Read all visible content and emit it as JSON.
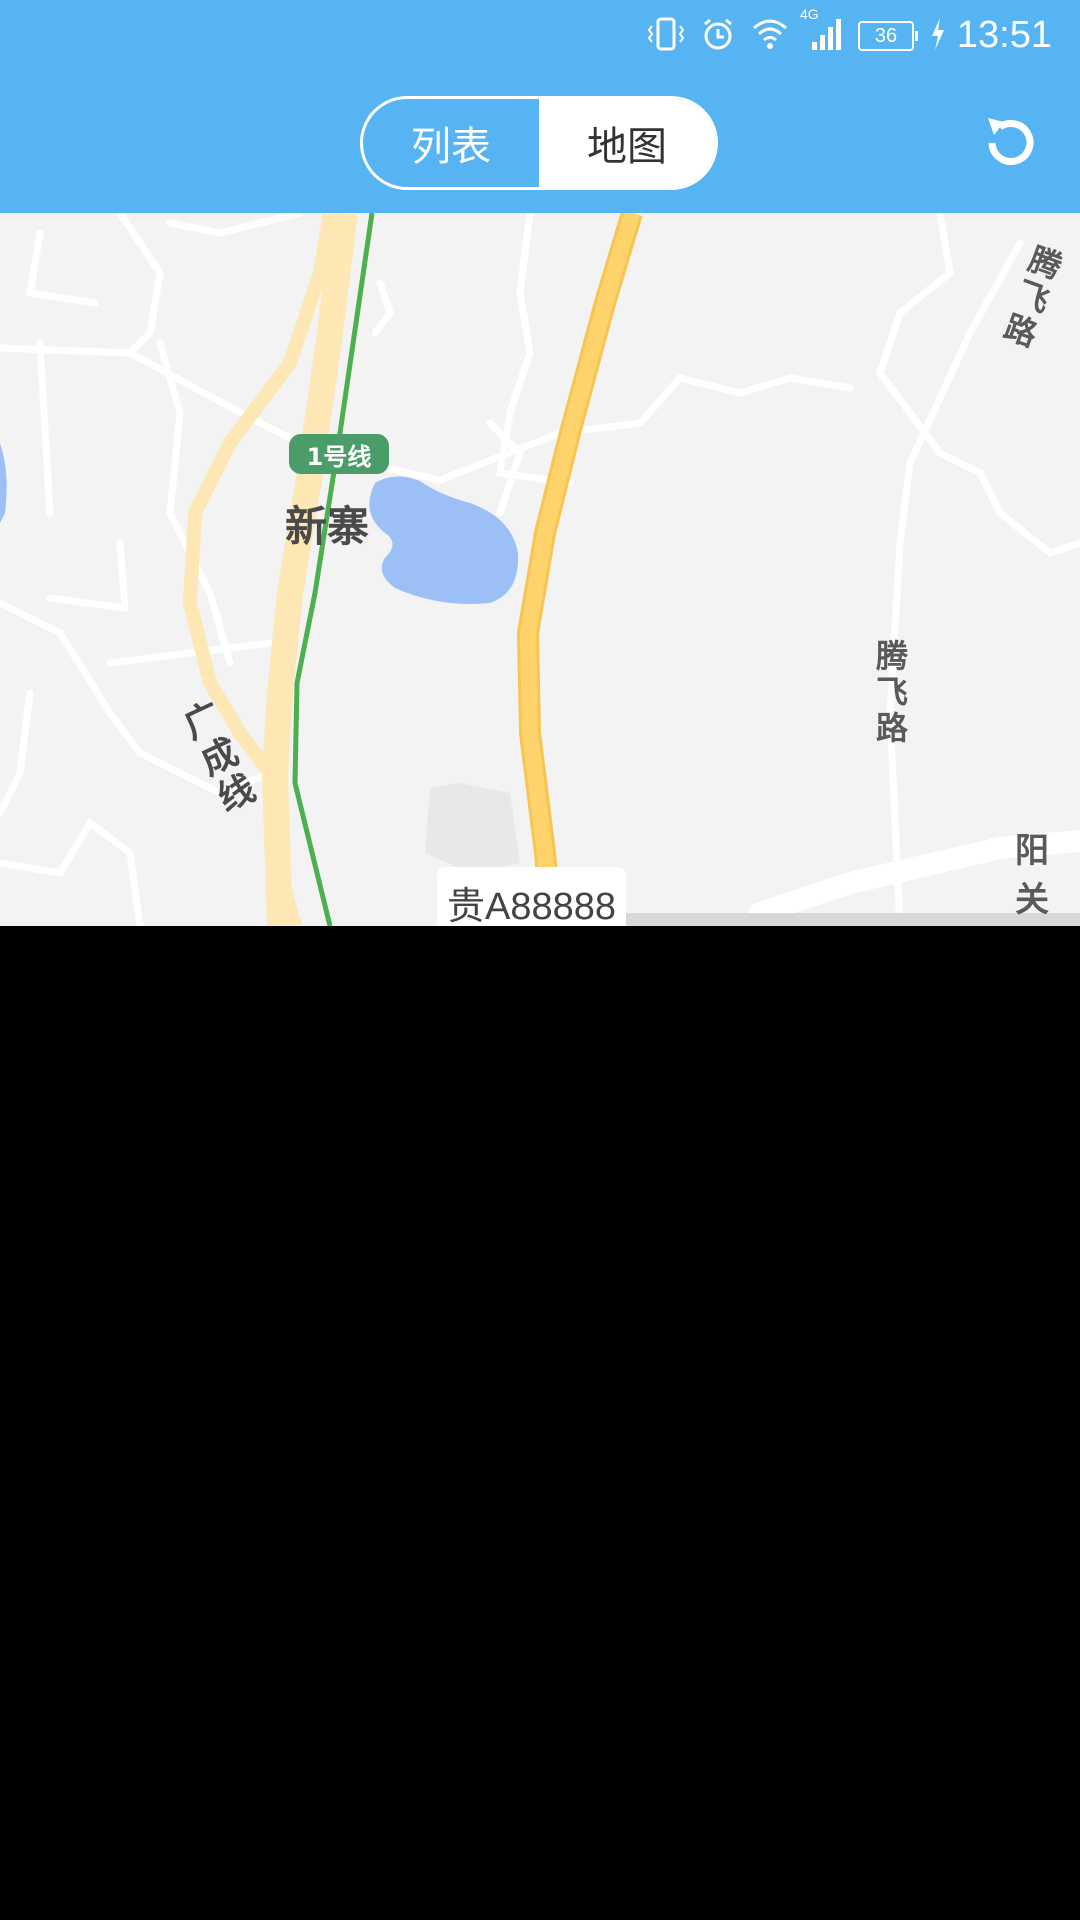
{
  "status_bar": {
    "time": "13:51",
    "battery": "36",
    "network": "4G",
    "icons": [
      "vibrate-icon",
      "alarm-icon",
      "wifi-icon",
      "signal-icon",
      "battery-icon",
      "charging-icon"
    ]
  },
  "header": {
    "tabs": [
      {
        "label": "列表",
        "active": false
      },
      {
        "label": "地图",
        "active": true
      }
    ],
    "refresh_icon": "refresh-icon"
  },
  "map": {
    "metro_line": "1号线",
    "place_name": "新寨",
    "roads": {
      "tengfei_top": "腾飞路",
      "tengfei_mid": "腾飞路",
      "guangcheng": "广成线",
      "yangguan": "阳关"
    },
    "vehicle_marker": "贵A88888"
  },
  "colors": {
    "header_bg": "#56b4f2",
    "map_bg": "#f3f3f3",
    "highway": "#ffd36b",
    "metro": "#4caf50",
    "water": "#9cc0f5"
  }
}
